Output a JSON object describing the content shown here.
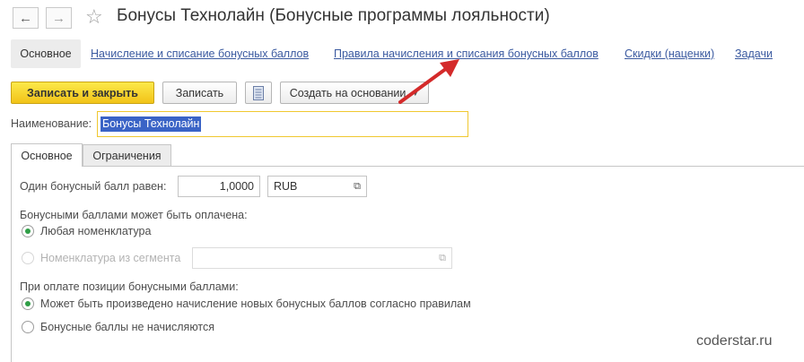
{
  "window": {
    "title": "Бонусы Технолайн (Бонусные программы лояльности)",
    "back_icon": "arrow-left-icon",
    "forward_icon": "arrow-right-icon",
    "favorite_icon": "star-icon"
  },
  "nav": {
    "items": [
      {
        "label": "Основное",
        "active": true
      },
      {
        "label": "Начисление и списание бонусных баллов"
      },
      {
        "label": "Правила начисления и списания бонусных баллов"
      },
      {
        "label": "Скидки (наценки)"
      },
      {
        "label": "Задачи"
      }
    ]
  },
  "toolbar": {
    "save_close": "Записать и закрыть",
    "save": "Записать",
    "report_icon": "document-list-icon",
    "create_based": "Создать на основании"
  },
  "form": {
    "name_label": "Наименование:",
    "name_value": "Бонусы Технолайн",
    "tabs": [
      "Основное",
      "Ограничения"
    ],
    "point_label": "Один бонусный балл равен:",
    "point_value": "1,0000",
    "currency": "RUB",
    "payable_label": "Бонусными баллами может быть оплачена:",
    "option_any": "Любая номенклатура",
    "option_segment": "Номенклатура из сегмента",
    "segment_value": "",
    "on_payment_label": "При оплате позиции бонусными баллами:",
    "option_accrue": "Может быть произведено начисление новых бонусных баллов согласно правилам",
    "option_no_accrue": "Бонусные баллы не начисляются"
  },
  "watermark": "coderstar.ru",
  "colors": {
    "primary_button": "#f2c318",
    "link": "#3b5aa0",
    "selection": "#3a63c6",
    "radio_checked": "#2f9e46",
    "annotation_arrow": "#d42a2a"
  }
}
